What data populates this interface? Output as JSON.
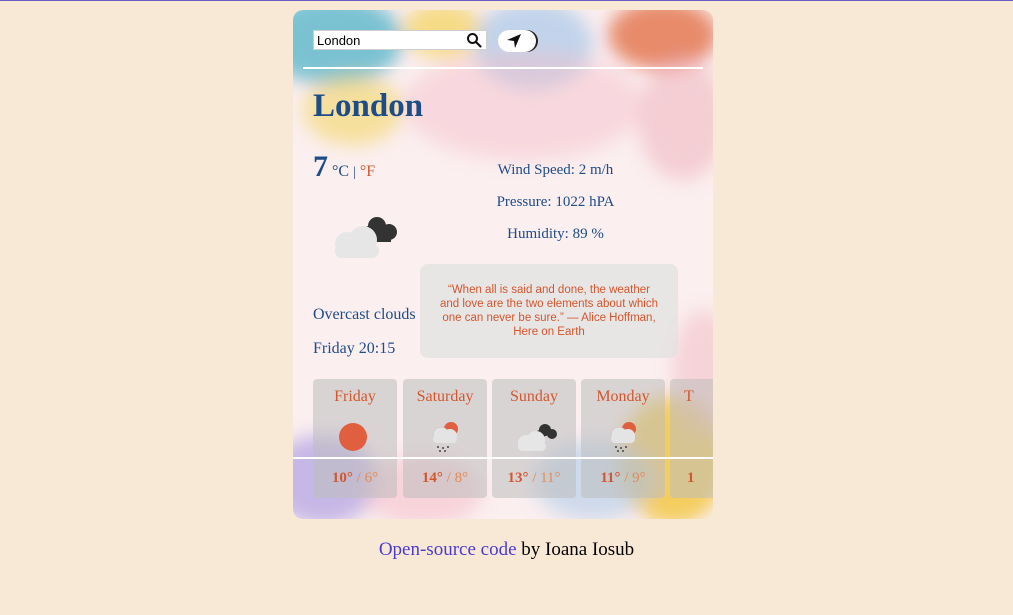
{
  "search": {
    "value": "London",
    "placeholder": ""
  },
  "city": "London",
  "current": {
    "temperature": "7",
    "unit_c": "°C",
    "unit_separator": "|",
    "unit_f": "°F",
    "icon": "overcast-clouds-icon",
    "description": "Overcast clouds",
    "datetime": "Friday 20:15"
  },
  "details": {
    "wind": "Wind Speed: 2 m/h",
    "pressure": "Pressure: 1022 hPA",
    "humidity": "Humidity: 89 %"
  },
  "quote": "“When all is said and done, the weather and love are the two elements about which one can never be sure.” — Alice Hoffman, Here on Earth",
  "forecast": [
    {
      "day": "Friday",
      "high": "10°",
      "low": "6°",
      "icon": "sun-icon"
    },
    {
      "day": "Saturday",
      "high": "14°",
      "low": "8°",
      "icon": "rain-cloud-sun-icon"
    },
    {
      "day": "Sunday",
      "high": "13°",
      "low": "11°",
      "icon": "overcast-clouds-icon"
    },
    {
      "day": "Monday",
      "high": "11°",
      "low": "9°",
      "icon": "rain-cloud-sun-icon"
    },
    {
      "day": "T",
      "high": "1",
      "low": "",
      "icon": ""
    }
  ],
  "forecast_separator": "/",
  "footer": {
    "link_text": "Open-source code",
    "suffix": " by Ioana Iosub"
  },
  "colors": {
    "primary": "#1e4c86",
    "accent": "#d2572e",
    "page_bg": "#f8e9d6",
    "link": "#4b3bd0"
  }
}
